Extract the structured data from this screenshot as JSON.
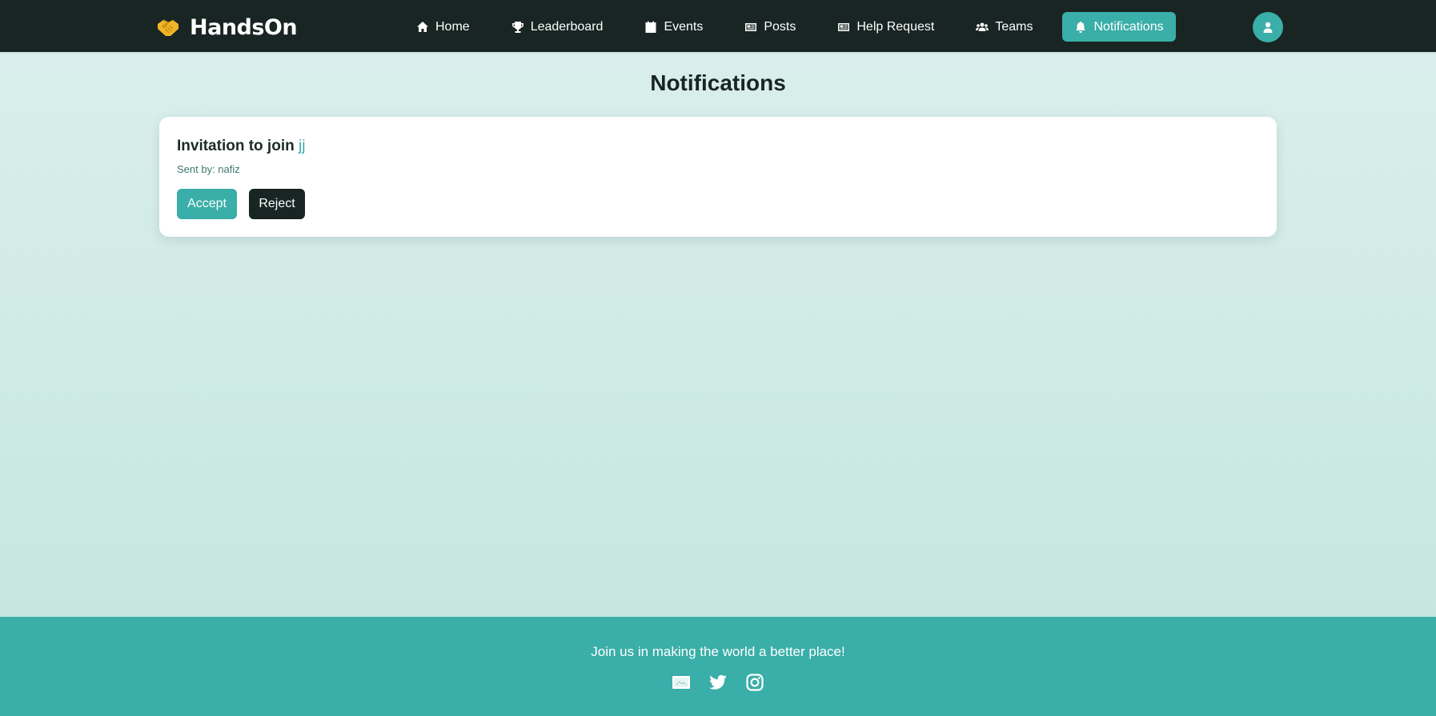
{
  "brand": {
    "name": "HandsOn",
    "icon": "handshake-icon",
    "icon_color": "#f0b429"
  },
  "nav": {
    "items": [
      {
        "label": "Home",
        "icon": "home-icon"
      },
      {
        "label": "Leaderboard",
        "icon": "trophy-icon"
      },
      {
        "label": "Events",
        "icon": "calendar-icon"
      },
      {
        "label": "Posts",
        "icon": "newspaper-icon"
      },
      {
        "label": "Help Request",
        "icon": "newspaper-icon"
      },
      {
        "label": "Teams",
        "icon": "users-icon"
      },
      {
        "label": "Notifications",
        "icon": "bell-icon",
        "active": true
      }
    ],
    "profile_icon": "user-icon"
  },
  "page": {
    "title": "Notifications"
  },
  "notification": {
    "title_prefix": "Invitation to join",
    "team_name": "jj",
    "sent_by": "Sent by: nafiz",
    "accept_label": "Accept",
    "reject_label": "Reject"
  },
  "footer": {
    "tagline": "Join us in making the world a better place!",
    "social": [
      "envelope-icon",
      "twitter-icon",
      "instagram-icon"
    ]
  },
  "colors": {
    "navbar": "#182523",
    "accent": "#3aaea8",
    "dark_button": "#182523",
    "background_top": "#dbefed",
    "background_bottom": "#c4e5dd"
  }
}
